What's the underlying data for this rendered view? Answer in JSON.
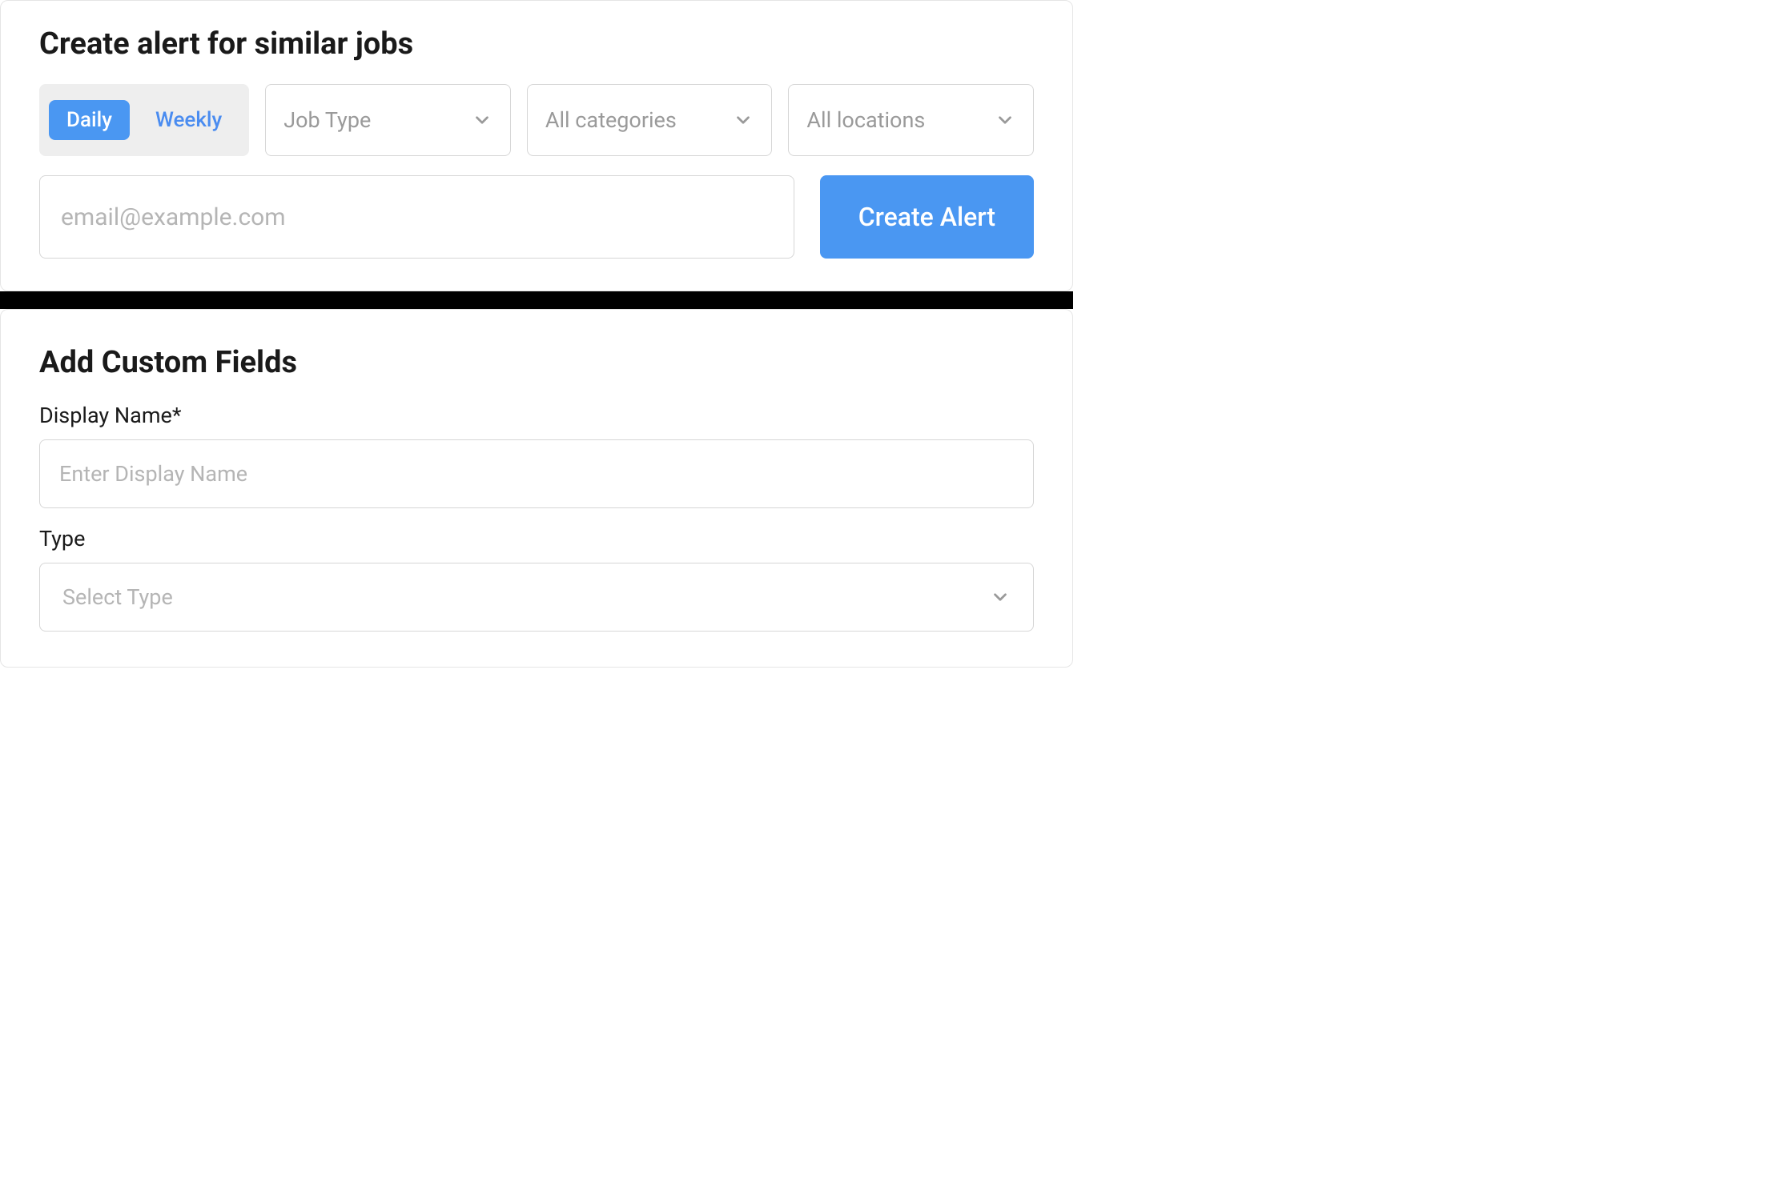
{
  "alert": {
    "title": "Create alert for similar jobs",
    "frequency": {
      "daily": "Daily",
      "weekly": "Weekly"
    },
    "dropdowns": {
      "jobType": "Job Type",
      "categories": "All categories",
      "locations": "All locations"
    },
    "email": {
      "placeholder": "email@example.com",
      "value": ""
    },
    "createButton": "Create Alert"
  },
  "customFields": {
    "title": "Add Custom Fields",
    "displayName": {
      "label": "Display Name*",
      "placeholder": "Enter Display Name",
      "value": ""
    },
    "type": {
      "label": "Type",
      "placeholder": "Select Type"
    }
  }
}
